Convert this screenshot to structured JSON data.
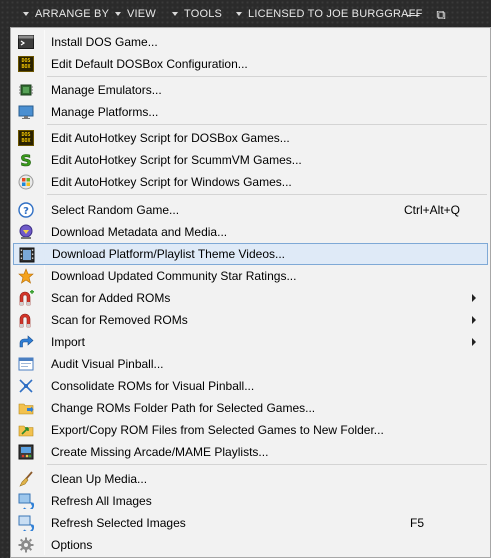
{
  "topbar": {
    "items": [
      {
        "label": "ARRANGE BY"
      },
      {
        "label": "VIEW"
      },
      {
        "label": "TOOLS"
      },
      {
        "label": "LICENSED TO JOE BURGGRAFF"
      }
    ],
    "minimize": "—",
    "restore": "⧉"
  },
  "menu": {
    "items": [
      {
        "label": "Install DOS Game...",
        "icon": "terminal-icon"
      },
      {
        "label": "Edit Default DOSBox Configuration...",
        "icon": "dosbox-icon"
      },
      {
        "label": "Manage Emulators...",
        "icon": "chip-icon"
      },
      {
        "label": "Manage Platforms...",
        "icon": "monitor-icon"
      },
      {
        "label": "Edit AutoHotkey Script for DOSBox Games...",
        "icon": "dosbox-icon"
      },
      {
        "label": "Edit AutoHotkey Script for ScummVM Games...",
        "icon": "scummvm-icon"
      },
      {
        "label": "Edit AutoHotkey Script for Windows Games...",
        "icon": "windows-icon"
      },
      {
        "label": "Select Random Game...",
        "icon": "question-icon",
        "shortcut": "Ctrl+Alt+Q"
      },
      {
        "label": "Download Metadata and Media...",
        "icon": "download-icon"
      },
      {
        "label": "Download Platform/Playlist Theme Videos...",
        "icon": "film-icon",
        "highlighted": true
      },
      {
        "label": "Download Updated Community Star Ratings...",
        "icon": "star-icon"
      },
      {
        "label": "Scan for Added ROMs",
        "icon": "magnet-add-icon",
        "submenu": true
      },
      {
        "label": "Scan for Removed ROMs",
        "icon": "magnet-remove-icon",
        "submenu": true
      },
      {
        "label": "Import",
        "icon": "import-arrow-icon",
        "submenu": true
      },
      {
        "label": "Audit Visual Pinball...",
        "icon": "window-icon"
      },
      {
        "label": "Consolidate ROMs for Visual Pinball...",
        "icon": "consolidate-icon"
      },
      {
        "label": "Change ROMs Folder Path for Selected Games...",
        "icon": "folder-path-icon"
      },
      {
        "label": "Export/Copy ROM Files from Selected Games to New Folder...",
        "icon": "export-folder-icon"
      },
      {
        "label": "Create Missing Arcade/MAME Playlists...",
        "icon": "arcade-icon"
      },
      {
        "label": "Clean Up Media...",
        "icon": "broom-icon"
      },
      {
        "label": "Refresh All Images",
        "icon": "refresh-images-icon"
      },
      {
        "label": "Refresh Selected Images",
        "icon": "refresh-selected-icon",
        "shortcut": "F5"
      },
      {
        "label": "Options",
        "icon": "gear-icon"
      }
    ]
  },
  "colors": {
    "menu_bg": "#f2f2f2",
    "highlight_bg": "#dfeaf7",
    "highlight_border": "#7fa9d6",
    "topbar_text": "#e8e8e8"
  }
}
